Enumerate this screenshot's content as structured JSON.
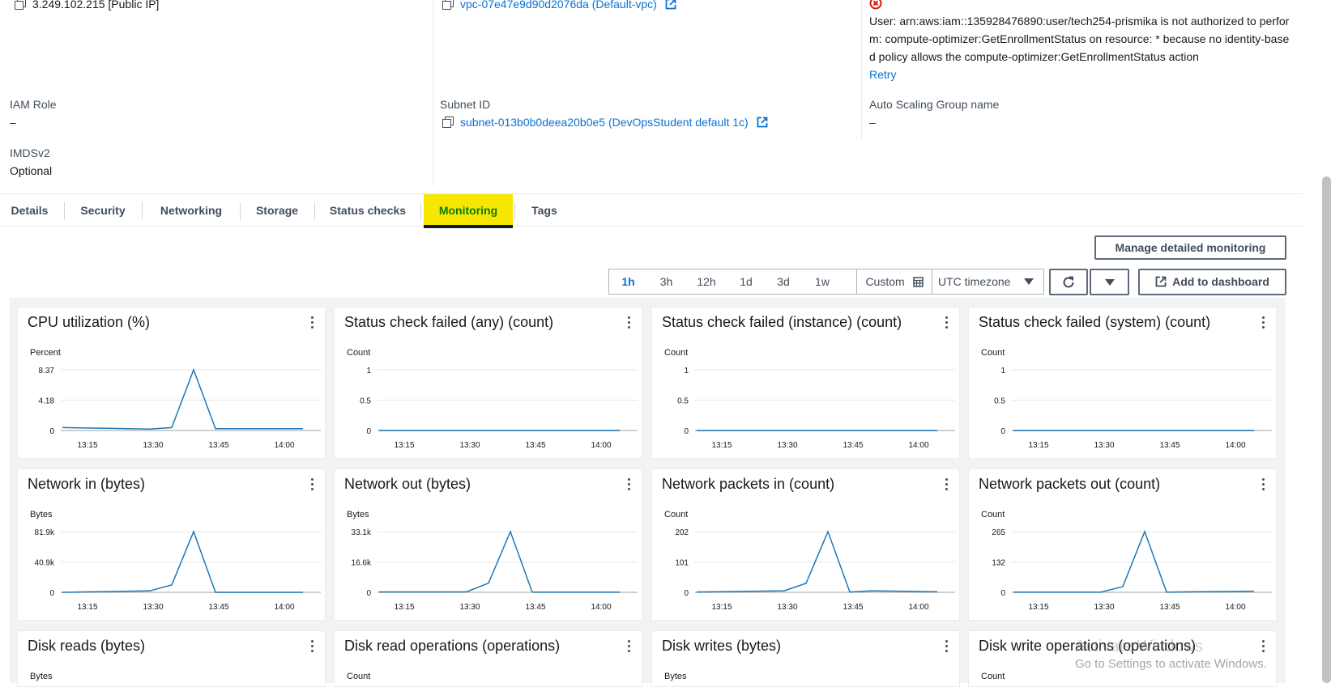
{
  "details": {
    "public_ip": "3.249.102.215 [Public IP]",
    "vpc_id": "vpc-07e47e9d90d2076da (Default-vpc)",
    "error_text": "User: arn:aws:iam::135928476890:user/tech254-prismika is not authorized to perform: compute-optimizer:GetEnrollmentStatus on resource: * because no identity-based policy allows the compute-optimizer:GetEnrollmentStatus action",
    "retry_label": "Retry",
    "iam_role_label": "IAM Role",
    "iam_role_value": "–",
    "subnet_label": "Subnet ID",
    "subnet_value": "subnet-013b0b0deea20b0e5 (DevOpsStudent default 1c)",
    "asg_label": "Auto Scaling Group name",
    "asg_value": "–",
    "imds_label": "IMDSv2",
    "imds_value": "Optional"
  },
  "tabs": [
    {
      "label": "Details"
    },
    {
      "label": "Security"
    },
    {
      "label": "Networking"
    },
    {
      "label": "Storage"
    },
    {
      "label": "Status checks"
    },
    {
      "label": "Monitoring",
      "active": true
    },
    {
      "label": "Tags"
    }
  ],
  "toolbar": {
    "manage_label": "Manage detailed monitoring",
    "ranges": [
      "1h",
      "3h",
      "12h",
      "1d",
      "3d",
      "1w"
    ],
    "active_range": "1h",
    "custom_label": "Custom",
    "timezone": "UTC timezone",
    "add_dashboard_label": "Add to dashboard"
  },
  "colors": {
    "line": "#1f77b4",
    "accent": "#0972d3",
    "highlight": "#f7e600"
  },
  "chart_data": [
    {
      "type": "line",
      "title": "CPU utilization (%)",
      "ylabel": "Percent",
      "yticks": [
        "8.37",
        "4.18",
        "0"
      ],
      "ylim": [
        0,
        8.37
      ],
      "x": [
        "13:10",
        "13:15",
        "13:20",
        "13:25",
        "13:30",
        "13:35",
        "13:40",
        "13:45",
        "13:50",
        "13:55",
        "14:00",
        "14:05"
      ],
      "xticks": [
        "13:15",
        "13:30",
        "13:45",
        "14:00"
      ],
      "series": [
        {
          "values": [
            0.4,
            0.35,
            0.3,
            0.25,
            0.2,
            0.4,
            8.37,
            0.25,
            0.25,
            0.25,
            0.25,
            0.25
          ]
        }
      ]
    },
    {
      "type": "line",
      "title": "Status check failed (any) (count)",
      "ylabel": "Count",
      "yticks": [
        "1",
        "0.5",
        "0"
      ],
      "ylim": [
        0,
        1
      ],
      "x": [
        "13:10",
        "13:15",
        "13:20",
        "13:25",
        "13:30",
        "13:35",
        "13:40",
        "13:45",
        "13:50",
        "13:55",
        "14:00",
        "14:05"
      ],
      "xticks": [
        "13:15",
        "13:30",
        "13:45",
        "14:00"
      ],
      "series": [
        {
          "values": [
            0,
            0,
            0,
            0,
            0,
            0,
            0,
            0,
            0,
            0,
            0,
            0
          ]
        }
      ]
    },
    {
      "type": "line",
      "title": "Status check failed (instance) (count)",
      "ylabel": "Count",
      "yticks": [
        "1",
        "0.5",
        "0"
      ],
      "ylim": [
        0,
        1
      ],
      "x": [
        "13:10",
        "13:15",
        "13:20",
        "13:25",
        "13:30",
        "13:35",
        "13:40",
        "13:45",
        "13:50",
        "13:55",
        "14:00",
        "14:05"
      ],
      "xticks": [
        "13:15",
        "13:30",
        "13:45",
        "14:00"
      ],
      "series": [
        {
          "values": [
            0,
            0,
            0,
            0,
            0,
            0,
            0,
            0,
            0,
            0,
            0,
            0
          ]
        }
      ]
    },
    {
      "type": "line",
      "title": "Status check failed (system) (count)",
      "ylabel": "Count",
      "yticks": [
        "1",
        "0.5",
        "0"
      ],
      "ylim": [
        0,
        1
      ],
      "x": [
        "13:10",
        "13:15",
        "13:20",
        "13:25",
        "13:30",
        "13:35",
        "13:40",
        "13:45",
        "13:50",
        "13:55",
        "14:00",
        "14:05"
      ],
      "xticks": [
        "13:15",
        "13:30",
        "13:45",
        "14:00"
      ],
      "series": [
        {
          "values": [
            0,
            0,
            0,
            0,
            0,
            0,
            0,
            0,
            0,
            0,
            0,
            0
          ]
        }
      ]
    },
    {
      "type": "line",
      "title": "Network in (bytes)",
      "ylabel": "Bytes",
      "yticks": [
        "81.9k",
        "40.9k",
        "0"
      ],
      "ylim": [
        0,
        81900
      ],
      "x": [
        "13:10",
        "13:15",
        "13:20",
        "13:25",
        "13:30",
        "13:35",
        "13:40",
        "13:45",
        "13:50",
        "13:55",
        "14:00",
        "14:05"
      ],
      "xticks": [
        "13:15",
        "13:30",
        "13:45",
        "14:00"
      ],
      "series": [
        {
          "values": [
            0,
            500,
            1000,
            1500,
            2000,
            10000,
            81900,
            0,
            0,
            0,
            0,
            0
          ]
        }
      ]
    },
    {
      "type": "line",
      "title": "Network out (bytes)",
      "ylabel": "Bytes",
      "yticks": [
        "33.1k",
        "16.6k",
        "0"
      ],
      "ylim": [
        0,
        33100
      ],
      "x": [
        "13:10",
        "13:15",
        "13:20",
        "13:25",
        "13:30",
        "13:35",
        "13:40",
        "13:45",
        "13:50",
        "13:55",
        "14:00",
        "14:05"
      ],
      "xticks": [
        "13:15",
        "13:30",
        "13:45",
        "14:00"
      ],
      "series": [
        {
          "values": [
            200,
            200,
            200,
            200,
            300,
            5000,
            33100,
            100,
            100,
            100,
            100,
            100
          ]
        }
      ]
    },
    {
      "type": "line",
      "title": "Network packets in (count)",
      "ylabel": "Count",
      "yticks": [
        "202",
        "101",
        "0"
      ],
      "ylim": [
        0,
        202
      ],
      "x": [
        "13:10",
        "13:15",
        "13:20",
        "13:25",
        "13:30",
        "13:35",
        "13:40",
        "13:45",
        "13:50",
        "13:55",
        "14:00",
        "14:05"
      ],
      "xticks": [
        "13:15",
        "13:30",
        "13:45",
        "14:00"
      ],
      "series": [
        {
          "values": [
            1,
            2,
            3,
            4,
            5,
            30,
            202,
            1,
            5,
            4,
            3,
            2
          ]
        }
      ]
    },
    {
      "type": "line",
      "title": "Network packets out (count)",
      "ylabel": "Count",
      "yticks": [
        "265",
        "132",
        "0"
      ],
      "ylim": [
        0,
        265
      ],
      "x": [
        "13:10",
        "13:15",
        "13:20",
        "13:25",
        "13:30",
        "13:35",
        "13:40",
        "13:45",
        "13:50",
        "13:55",
        "14:00",
        "14:05"
      ],
      "xticks": [
        "13:15",
        "13:30",
        "13:45",
        "14:00"
      ],
      "series": [
        {
          "values": [
            1,
            1,
            1,
            1,
            1,
            25,
            265,
            1,
            2,
            3,
            4,
            5
          ]
        }
      ]
    },
    {
      "type": "line",
      "title": "Disk reads (bytes)",
      "ylabel": "Bytes"
    },
    {
      "type": "line",
      "title": "Disk read operations (operations)",
      "ylabel": "Count"
    },
    {
      "type": "line",
      "title": "Disk writes (bytes)",
      "ylabel": "Bytes"
    },
    {
      "type": "line",
      "title": "Disk write operations (operations)",
      "ylabel": "Count"
    }
  ],
  "watermark": {
    "line1": "Activate Windows",
    "line2": "Go to Settings to activate Windows."
  }
}
